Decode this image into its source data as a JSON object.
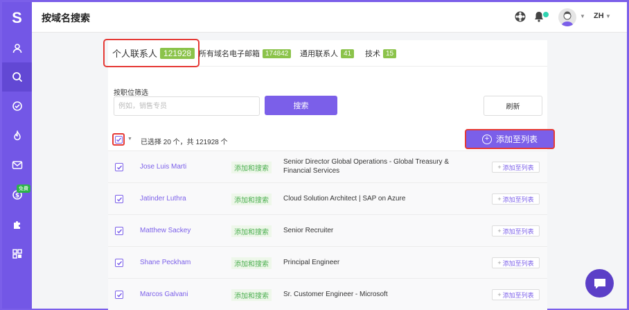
{
  "app": {
    "logo": "S",
    "page_title": "按域名搜索"
  },
  "sidebar": {
    "items": [
      {
        "icon": "user-icon"
      },
      {
        "icon": "search-icon",
        "active": true
      },
      {
        "icon": "check-circle-icon"
      },
      {
        "icon": "fire-icon"
      },
      {
        "icon": "mail-icon"
      },
      {
        "icon": "dollar-icon",
        "badge": "免費"
      },
      {
        "icon": "puzzle-icon"
      },
      {
        "icon": "grid-icon"
      }
    ]
  },
  "topbar": {
    "lang": "ZH"
  },
  "tabs": [
    {
      "label": "个人联系人",
      "count": "121928",
      "active": true
    },
    {
      "label": "所有域名电子邮箱",
      "count": "174842"
    },
    {
      "label": "通用联系人",
      "count": "41"
    },
    {
      "label": "技术",
      "count": "15"
    }
  ],
  "filter": {
    "label": "按职位筛选",
    "placeholder": "例如，销售专员",
    "value": "",
    "search_label": "搜索",
    "refresh_label": "刷新"
  },
  "selection": {
    "text": "已选择 20 个，共 121928 个",
    "add_to_list_label": "添加至列表"
  },
  "rows": [
    {
      "name": "Jose Luis Marti",
      "enrich": "添加和搜索",
      "title": "Senior Director Global Operations - Global Treasury & Financial Services",
      "add": "添加至列表"
    },
    {
      "name": "Jatinder Luthra",
      "enrich": "添加和搜索",
      "title": "Cloud Solution Architect | SAP on Azure",
      "add": "添加至列表"
    },
    {
      "name": "Matthew Sackey",
      "enrich": "添加和搜索",
      "title": "Senior Recruiter",
      "add": "添加至列表"
    },
    {
      "name": "Shane Peckham",
      "enrich": "添加和搜索",
      "title": "Principal Engineer",
      "add": "添加至列表"
    },
    {
      "name": "Marcos Galvani",
      "enrich": "添加和搜索",
      "title": "Sr. Customer Engineer - Microsoft",
      "add": "添加至列表"
    }
  ],
  "colors": {
    "accent": "#7b5fe9",
    "highlight": "#e53935",
    "badge": "#8bc34a"
  }
}
